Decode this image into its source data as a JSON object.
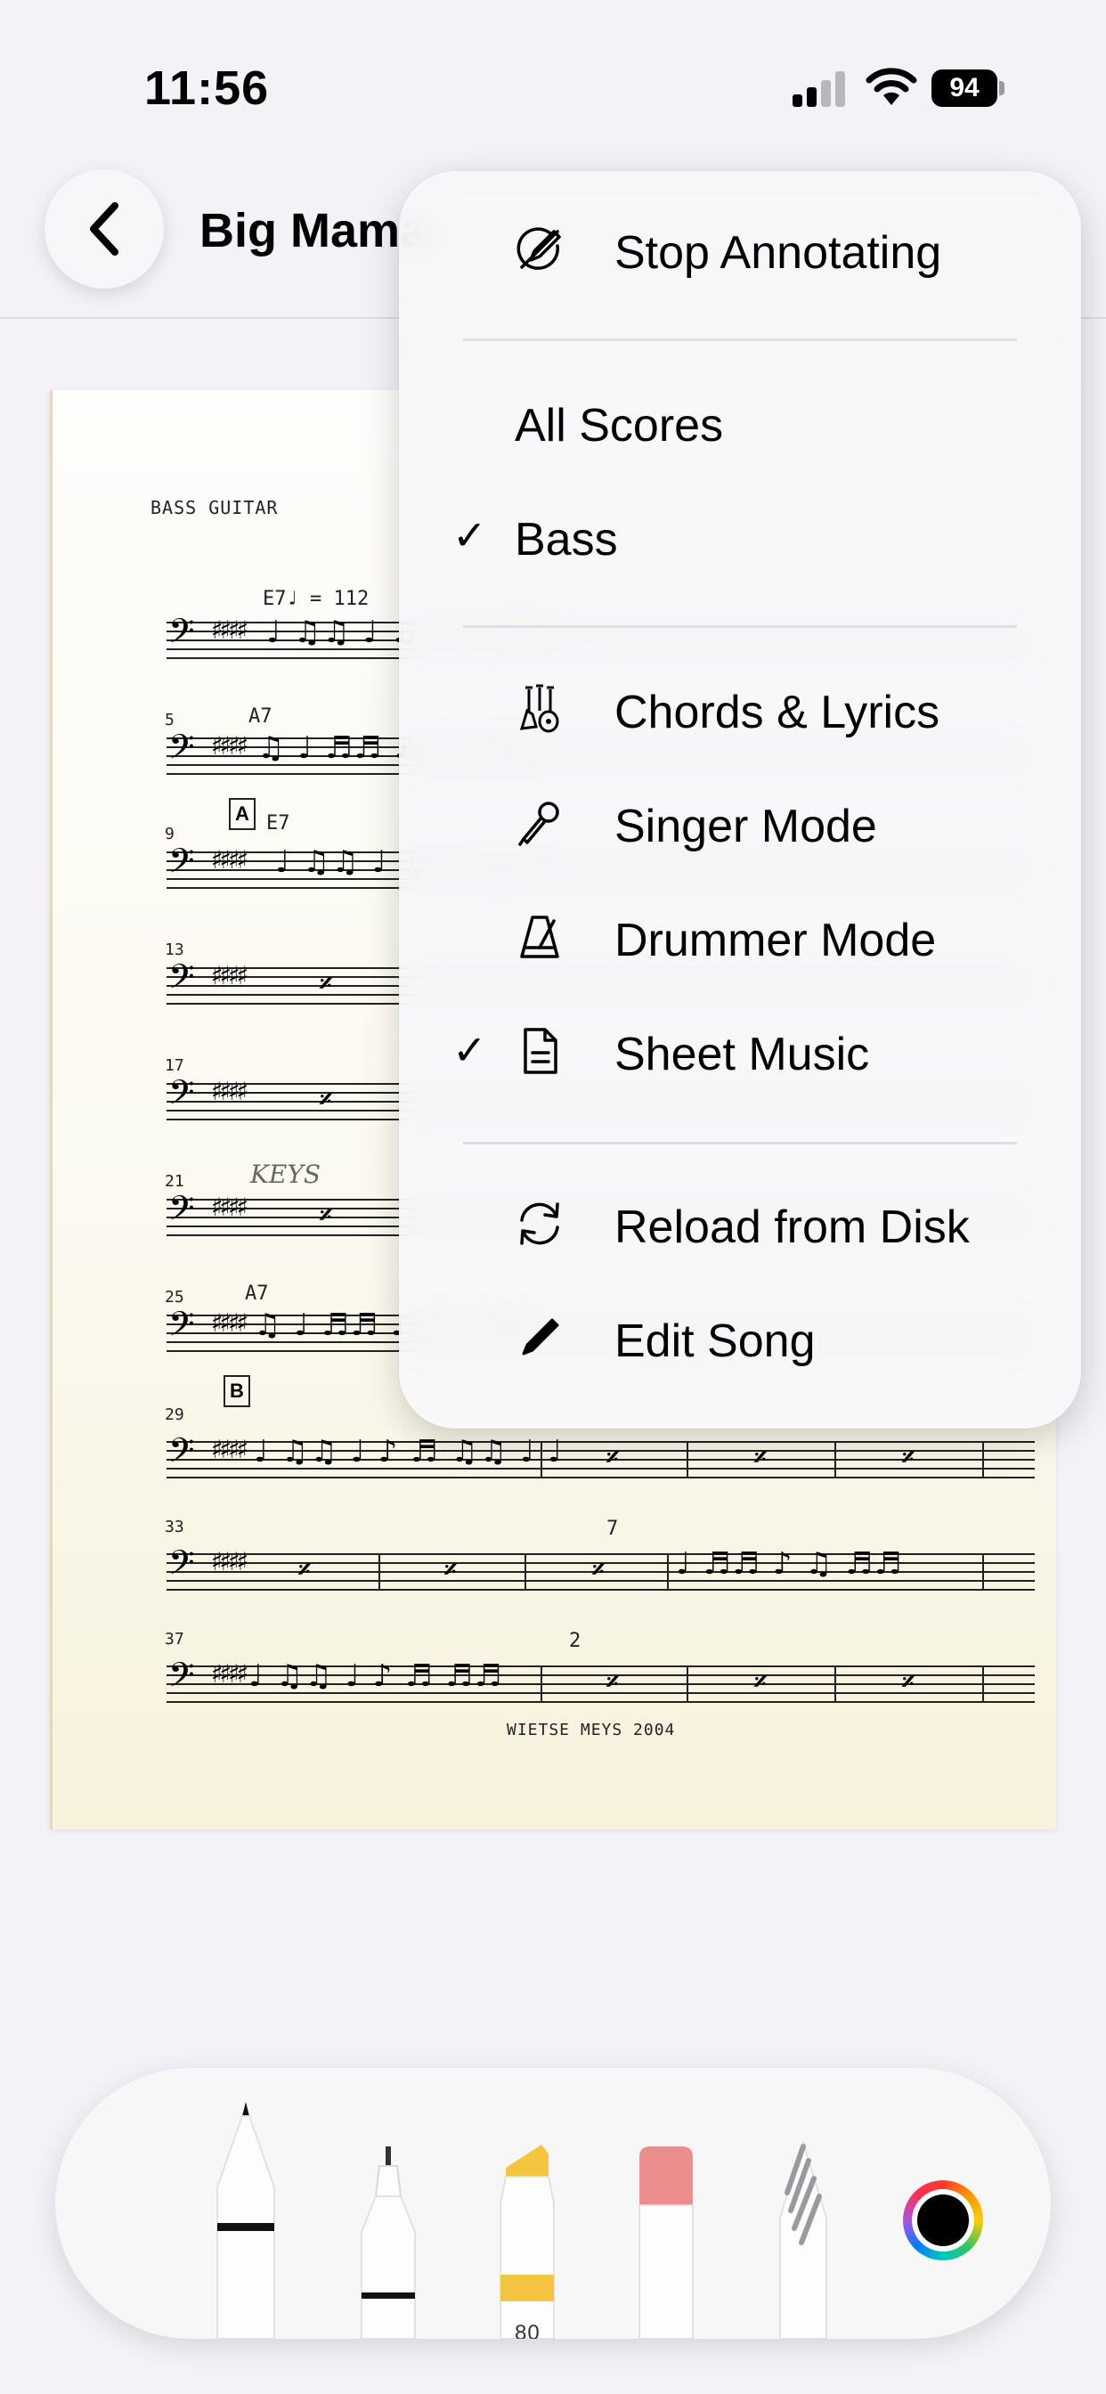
{
  "status": {
    "time": "11:56",
    "battery": "94"
  },
  "nav": {
    "title": "Big Mama"
  },
  "sheet": {
    "header": "BASS GUITAR",
    "tempo_chord": "E7♩ = 112",
    "staff_numbers": [
      "5",
      "9",
      "13",
      "17",
      "21",
      "25",
      "29",
      "33",
      "37"
    ],
    "chords": [
      "A7",
      "E7",
      "A7"
    ],
    "rehearsal_marks": [
      "A",
      "B"
    ],
    "hand_note": "KEYS",
    "bar_counts": [
      "7",
      "2"
    ],
    "credit": "WIETSE MEYS 2004"
  },
  "menu": {
    "stop_annotating": "Stop Annotating",
    "all_scores": "All Scores",
    "bass": "Bass",
    "chords_lyrics": "Chords & Lyrics",
    "singer_mode": "Singer Mode",
    "drummer_mode": "Drummer Mode",
    "sheet_music": "Sheet Music",
    "reload": "Reload from Disk",
    "edit_song": "Edit Song",
    "checkmark": "✓"
  },
  "toolbar": {
    "highlighter_size": "80"
  },
  "colors": {
    "highlighter": "#f5c542",
    "eraser": "#ec8e8e",
    "selected_color": "#000000"
  }
}
